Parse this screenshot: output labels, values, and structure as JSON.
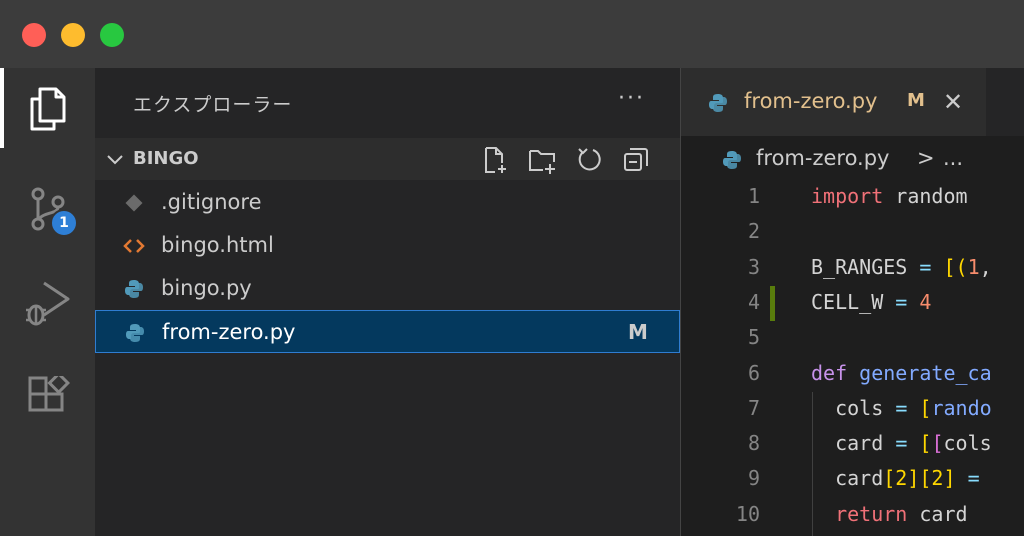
{
  "window": {
    "traffic_lights": [
      "close",
      "minimize",
      "zoom"
    ]
  },
  "activity_bar": {
    "items": [
      {
        "name": "explorer",
        "icon": "files-icon",
        "active": true
      },
      {
        "name": "source-control",
        "icon": "source-control-icon",
        "badge": "1"
      },
      {
        "name": "run-and-debug",
        "icon": "run-debug-icon"
      },
      {
        "name": "extensions",
        "icon": "extensions-icon"
      }
    ]
  },
  "sidebar": {
    "title": "エクスプローラー",
    "more": "···",
    "folder": {
      "name": "BINGO",
      "actions": [
        "new-file-icon",
        "new-folder-icon",
        "refresh-icon",
        "collapse-all-icon"
      ]
    },
    "files": [
      {
        "name": ".gitignore",
        "icon": "git-file-icon"
      },
      {
        "name": "bingo.html",
        "icon": "html-file-icon"
      },
      {
        "name": "bingo.py",
        "icon": "python-file-icon"
      },
      {
        "name": "from-zero.py",
        "icon": "python-file-icon",
        "selected": true,
        "status": "M"
      }
    ]
  },
  "editor": {
    "tab": {
      "name": "from-zero.py",
      "status": "M",
      "close": "✕"
    },
    "breadcrumb": {
      "file": "from-zero.py",
      "separator": ">",
      "rest": "..."
    },
    "lines": [
      {
        "n": "1"
      },
      {
        "n": "2"
      },
      {
        "n": "3"
      },
      {
        "n": "4"
      },
      {
        "n": "5"
      },
      {
        "n": "6"
      },
      {
        "n": "7"
      },
      {
        "n": "8"
      },
      {
        "n": "9"
      },
      {
        "n": "10"
      }
    ],
    "code": {
      "l1_kw": "import",
      "l1_mod": "random",
      "l3_id": "B_RANGES",
      "l3_eq": "=",
      "l3_br": "[(",
      "l3_num": "1",
      "l3_comma": ",",
      "l4_id": "CELL_W",
      "l4_eq": "=",
      "l4_num": "4",
      "l6_kw": "def",
      "l6_fn": "generate_ca",
      "l7_id": "cols",
      "l7_eq": "=",
      "l7_br": "[",
      "l7_fn": "rando",
      "l8_id": "card",
      "l8_eq": "=",
      "l8_br": "[",
      "l8_br2": "[",
      "l8_id2": "cols",
      "l9_id": "card",
      "l9_idx": "[2][2]",
      "l9_eq": "=",
      "l10_kw": "return",
      "l10_id": "card"
    }
  },
  "colors": {
    "accent": "#2f7dd1",
    "modified": "#e2c08d",
    "badge": "#2e7fd6",
    "gutter_added": "#587c0c"
  }
}
